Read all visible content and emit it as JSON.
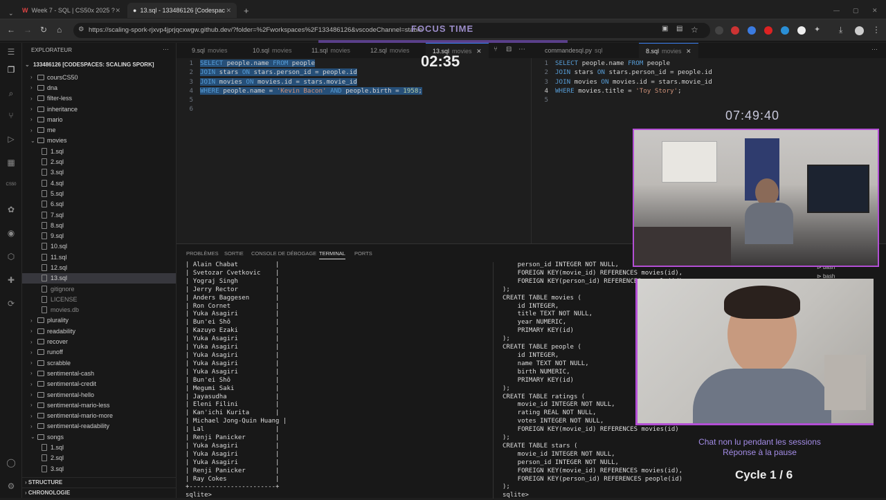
{
  "browser": {
    "tabs": [
      {
        "label": "Week 7 - SQL | CS50x 2025 ?",
        "active": false
      },
      {
        "label": "13.sql - 133486126 [Codespac",
        "active": true
      }
    ],
    "url": "https://scaling-spork-rjxvp4jprjqcxwgw.github.dev/?folder=%2Fworkspaces%2F133486126&vscodeChannel=stable"
  },
  "overlay": {
    "focus_label": "FOCUS TIME",
    "focus_timer": "02:35",
    "clock": "07:49:40",
    "chat_notice": "Chat non lu pendant les sessions",
    "chat_notice2": "Réponse à la pause",
    "cycle": "Cycle 1 / 6"
  },
  "explorer": {
    "title": "EXPLORATEUR",
    "root": "133486126 [CODESPACES: SCALING SPORK]",
    "items": [
      {
        "type": "folder",
        "label": "coursCS50",
        "indent": 1,
        "open": false
      },
      {
        "type": "folder",
        "label": "dna",
        "indent": 1,
        "open": false
      },
      {
        "type": "folder",
        "label": "filter-less",
        "indent": 1,
        "open": false
      },
      {
        "type": "folder",
        "label": "inheritance",
        "indent": 1,
        "open": false
      },
      {
        "type": "folder",
        "label": "mario",
        "indent": 1,
        "open": false
      },
      {
        "type": "folder",
        "label": "me",
        "indent": 1,
        "open": false
      },
      {
        "type": "folder",
        "label": "movies",
        "indent": 1,
        "open": true
      },
      {
        "type": "file",
        "label": "1.sql",
        "indent": 2
      },
      {
        "type": "file",
        "label": "2.sql",
        "indent": 2
      },
      {
        "type": "file",
        "label": "3.sql",
        "indent": 2
      },
      {
        "type": "file",
        "label": "4.sql",
        "indent": 2
      },
      {
        "type": "file",
        "label": "5.sql",
        "indent": 2
      },
      {
        "type": "file",
        "label": "6.sql",
        "indent": 2
      },
      {
        "type": "file",
        "label": "7.sql",
        "indent": 2
      },
      {
        "type": "file",
        "label": "8.sql",
        "indent": 2
      },
      {
        "type": "file",
        "label": "9.sql",
        "indent": 2
      },
      {
        "type": "file",
        "label": "10.sql",
        "indent": 2
      },
      {
        "type": "file",
        "label": "11.sql",
        "indent": 2
      },
      {
        "type": "file",
        "label": "12.sql",
        "indent": 2
      },
      {
        "type": "file",
        "label": "13.sql",
        "indent": 2,
        "selected": true
      },
      {
        "type": "file",
        "label": "gitignore",
        "indent": 2,
        "dim": true
      },
      {
        "type": "file",
        "label": "LICENSE",
        "indent": 2,
        "dim": true
      },
      {
        "type": "file",
        "label": "movies.db",
        "indent": 2,
        "dim": true
      },
      {
        "type": "folder",
        "label": "plurality",
        "indent": 1,
        "open": false
      },
      {
        "type": "folder",
        "label": "readability",
        "indent": 1,
        "open": false
      },
      {
        "type": "folder",
        "label": "recover",
        "indent": 1,
        "open": false
      },
      {
        "type": "folder",
        "label": "runoff",
        "indent": 1,
        "open": false
      },
      {
        "type": "folder",
        "label": "scrabble",
        "indent": 1,
        "open": false
      },
      {
        "type": "folder",
        "label": "sentimental-cash",
        "indent": 1,
        "open": false
      },
      {
        "type": "folder",
        "label": "sentimental-credit",
        "indent": 1,
        "open": false
      },
      {
        "type": "folder",
        "label": "sentimental-hello",
        "indent": 1,
        "open": false
      },
      {
        "type": "folder",
        "label": "sentimental-mario-less",
        "indent": 1,
        "open": false
      },
      {
        "type": "folder",
        "label": "sentimental-mario-more",
        "indent": 1,
        "open": false
      },
      {
        "type": "folder",
        "label": "sentimental-readability",
        "indent": 1,
        "open": false
      },
      {
        "type": "folder",
        "label": "songs",
        "indent": 1,
        "open": true
      },
      {
        "type": "file",
        "label": "1.sql",
        "indent": 2
      },
      {
        "type": "file",
        "label": "2.sql",
        "indent": 2
      },
      {
        "type": "file",
        "label": "3.sql",
        "indent": 2
      }
    ],
    "sections": [
      "STRUCTURE",
      "CHRONOLOGIE"
    ]
  },
  "editor": {
    "tabs": [
      {
        "label": "9.sql",
        "sub": "movies"
      },
      {
        "label": "10.sql",
        "sub": "movies"
      },
      {
        "label": "11.sql",
        "sub": "movies"
      },
      {
        "label": "12.sql",
        "sub": "movies"
      },
      {
        "label": "13.sql",
        "sub": "movies",
        "active": true
      }
    ],
    "tabs_right": [
      {
        "label": "commandesql.py",
        "sub": "sql"
      },
      {
        "label": "8.sql",
        "sub": "movies"
      }
    ],
    "left_lines": [
      [
        {
          "t": "SELECT ",
          "c": "kw"
        },
        {
          "t": "people.name ",
          "c": "id"
        },
        {
          "t": "FROM ",
          "c": "kw"
        },
        {
          "t": "people",
          "c": "id"
        }
      ],
      [
        {
          "t": "JOIN ",
          "c": "kw"
        },
        {
          "t": "stars ",
          "c": "id"
        },
        {
          "t": "ON ",
          "c": "kw"
        },
        {
          "t": "stars.person_id = people.id",
          "c": "id"
        }
      ],
      [
        {
          "t": "JOIN ",
          "c": "kw"
        },
        {
          "t": "movies ",
          "c": "id"
        },
        {
          "t": "ON ",
          "c": "kw"
        },
        {
          "t": "movies.id = stars.movie_id",
          "c": "id"
        }
      ],
      [
        {
          "t": "WHERE ",
          "c": "kw"
        },
        {
          "t": "people.name = ",
          "c": "id"
        },
        {
          "t": "'Kevin Bacon' ",
          "c": "str"
        },
        {
          "t": "AND ",
          "c": "kw"
        },
        {
          "t": "people.birth = ",
          "c": "id"
        },
        {
          "t": "1958",
          "c": "num"
        },
        {
          "t": ";",
          "c": "id"
        }
      ],
      [],
      []
    ],
    "right_lines": [
      [
        {
          "t": "SELECT ",
          "c": "kw"
        },
        {
          "t": "people.name ",
          "c": "id"
        },
        {
          "t": "FROM ",
          "c": "kw"
        },
        {
          "t": "people",
          "c": "id"
        }
      ],
      [
        {
          "t": "JOIN ",
          "c": "kw"
        },
        {
          "t": "stars ",
          "c": "id"
        },
        {
          "t": "ON ",
          "c": "kw"
        },
        {
          "t": "stars.person_id = people.id",
          "c": "id"
        }
      ],
      [
        {
          "t": "JOIN ",
          "c": "kw"
        },
        {
          "t": "movies ",
          "c": "id"
        },
        {
          "t": "ON ",
          "c": "kw"
        },
        {
          "t": "movies.id = stars.movie_id",
          "c": "id"
        }
      ],
      [
        {
          "t": "WHERE ",
          "c": "kw"
        },
        {
          "t": "movies.title = ",
          "c": "id"
        },
        {
          "t": "'Toy Story'",
          "c": "str"
        },
        {
          "t": ";",
          "c": "id"
        }
      ],
      []
    ]
  },
  "panel": {
    "tabs": [
      "PROBLÈMES",
      "SORTIE",
      "CONSOLE DE DÉBOGAGE",
      "TERMINAL",
      "PORTS"
    ],
    "active_tab": "TERMINAL",
    "terminal_left": "| Alain Chabat          |\n| Svetozar Cvetkovic    |\n| Yograj Singh          |\n| Jerry Rector          |\n| Anders Baggesen       |\n| Ron Cornet            |\n| Yuka Asagiri          |\n| Bun'ei Shô            |\n| Kazuyo Ezaki          |\n| Yuka Asagiri          |\n| Yuka Asagiri          |\n| Yuka Asagiri          |\n| Yuka Asagiri          |\n| Yuka Asagiri          |\n| Bun'ei Shô            |\n| Megumi Saki           |\n| Jayasudha             |\n| Eleni Filini          |\n| Kan'ichi Kurita       |\n| Michael Jong-Quin Huang |\n| Lal                   |\n| Renji Panicker        |\n| Yuka Asagiri          |\n| Yuka Asagiri          |\n| Yuka Asagiri          |\n| Renji Panicker        |\n| Ray Cokes             |\n+-----------------------+\nsqlite> ",
    "terminal_right": "    person_id INTEGER NOT NULL,\n    FOREIGN KEY(movie_id) REFERENCES movies(id),\n    FOREIGN KEY(person_id) REFERENCES people(id)\n);\nCREATE TABLE movies (\n    id INTEGER,\n    title TEXT NOT NULL,\n    year NUMERIC,\n    PRIMARY KEY(id)\n);\nCREATE TABLE people (\n    id INTEGER,\n    name TEXT NOT NULL,\n    birth NUMERIC,\n    PRIMARY KEY(id)\n);\nCREATE TABLE ratings (\n    movie_id INTEGER NOT NULL,\n    rating REAL NOT NULL,\n    votes INTEGER NOT NULL,\n    FOREIGN KEY(movie_id) REFERENCES movies(id)\n);\nCREATE TABLE stars (\n    movie_id INTEGER NOT NULL,\n    person_id INTEGER NOT NULL,\n    FOREIGN KEY(movie_id) REFERENCES movies(id),\n    FOREIGN KEY(person_id) REFERENCES people(id)\n);\nsqlite> ",
    "bash_labels": [
      "bash",
      "bash"
    ]
  }
}
